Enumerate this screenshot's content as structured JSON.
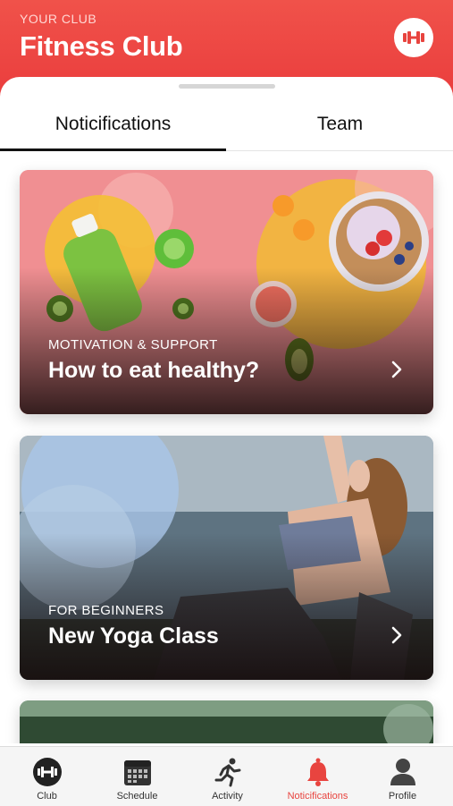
{
  "header": {
    "caption": "YOUR CLUB",
    "title": "Fitness Club",
    "action_icon": "dumbbell-icon"
  },
  "tabs": [
    {
      "label": "Noticifications",
      "active": true
    },
    {
      "label": "Team",
      "active": false
    }
  ],
  "cards": [
    {
      "tag": "MOTIVATION & SUPPORT",
      "title": "How to eat healthy?"
    },
    {
      "tag": "FOR BEGINNERS",
      "title": "New Yoga Class"
    }
  ],
  "tabbar": {
    "items": [
      {
        "label": "Club",
        "icon": "dumbbell-icon",
        "active": false
      },
      {
        "label": "Schedule",
        "icon": "calendar-icon",
        "active": false
      },
      {
        "label": "Activity",
        "icon": "runner-icon",
        "active": false
      },
      {
        "label": "Noticifications",
        "icon": "bell-icon",
        "active": true
      },
      {
        "label": "Profile",
        "icon": "person-icon",
        "active": false
      }
    ]
  },
  "colors": {
    "accent": "#ea3d3d",
    "header": "#f0524a",
    "active_tab_label": "#e8443f"
  }
}
